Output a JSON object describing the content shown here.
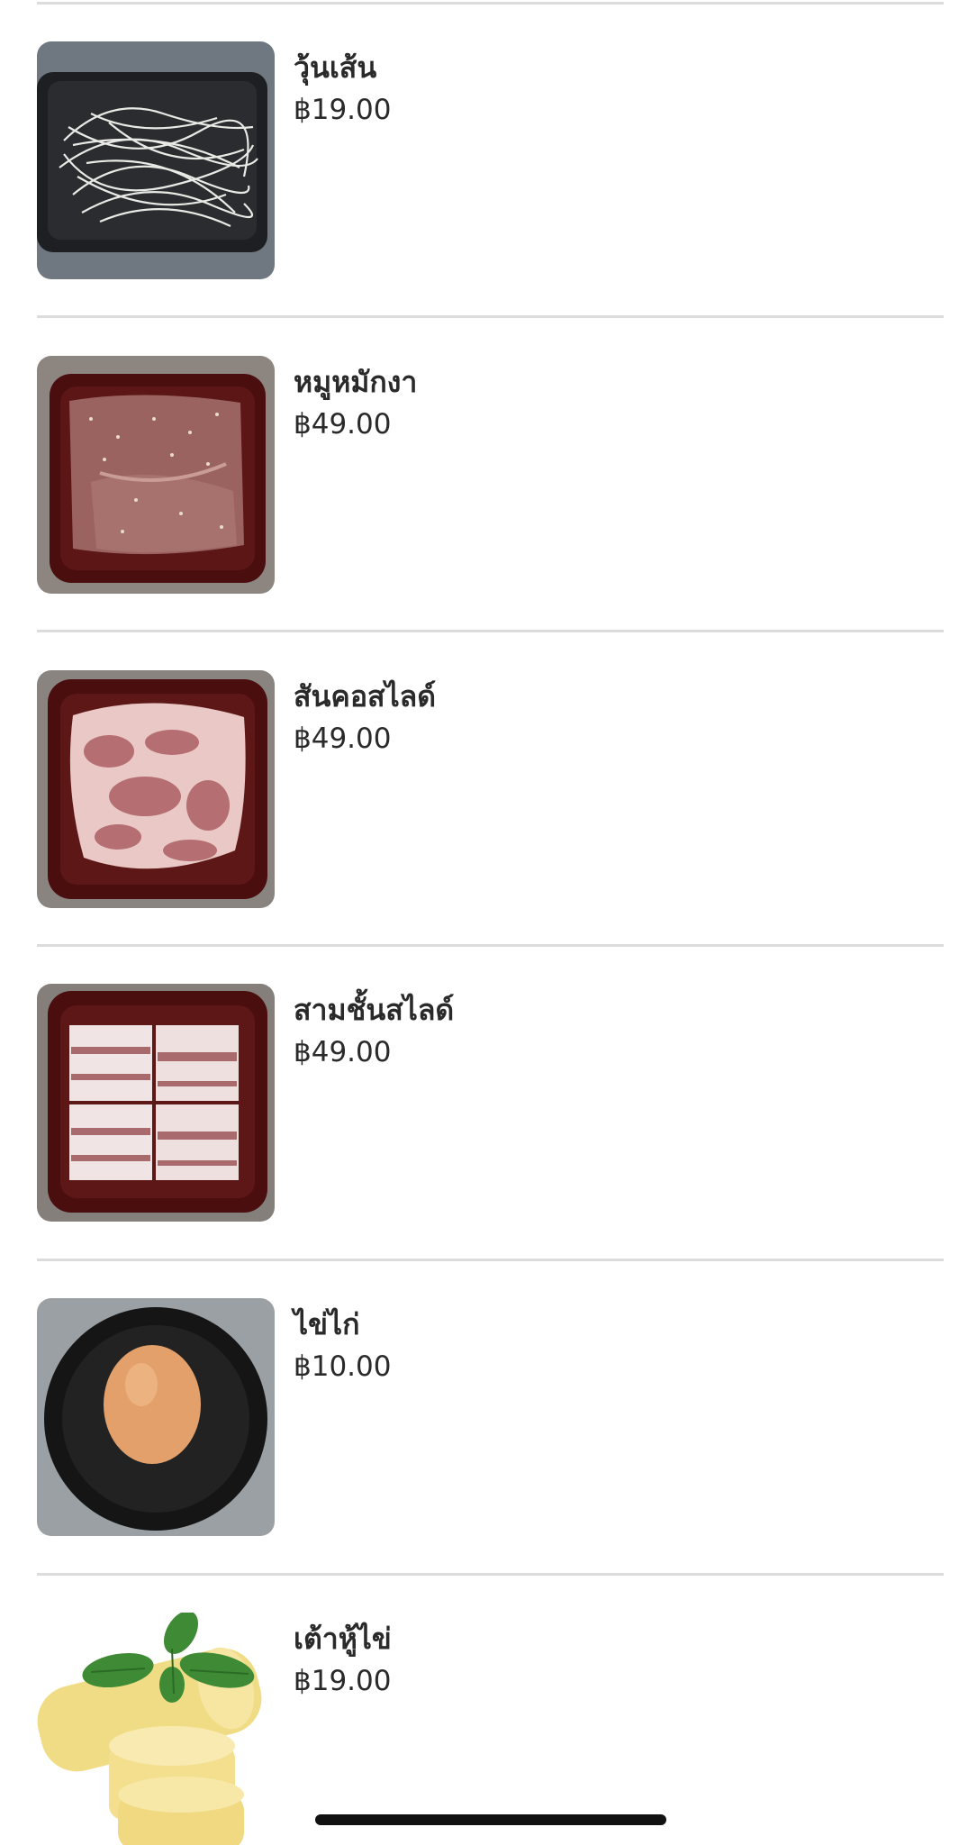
{
  "menu": {
    "items": [
      {
        "name": "วุ้นเส้น",
        "price": "฿19.00",
        "image": "glass-noodles-photo"
      },
      {
        "name": "หมูหมักงา",
        "price": "฿49.00",
        "image": "sesame-pork-photo"
      },
      {
        "name": "สันคอสไลด์",
        "price": "฿49.00",
        "image": "pork-collar-slice-photo"
      },
      {
        "name": "สามชั้นสไลด์",
        "price": "฿49.00",
        "image": "pork-belly-slice-photo"
      },
      {
        "name": "ไข่ไก่",
        "price": "฿10.00",
        "image": "chicken-egg-photo"
      },
      {
        "name": "เต้าหู้ไข่",
        "price": "฿19.00",
        "image": "egg-tofu-photo"
      }
    ]
  }
}
